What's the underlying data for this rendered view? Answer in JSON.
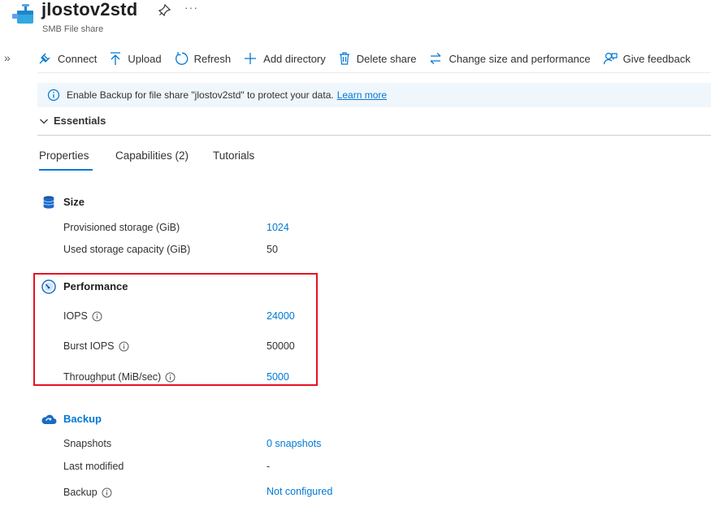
{
  "header": {
    "title": "jlostov2std",
    "subtitle": "SMB File share",
    "more": "···",
    "expand": "»"
  },
  "toolbar": {
    "connect": "Connect",
    "upload": "Upload",
    "refresh": "Refresh",
    "add_directory": "Add directory",
    "delete_share": "Delete share",
    "change_size": "Change size and performance",
    "give_feedback": "Give feedback"
  },
  "banner": {
    "text": "Enable Backup for file share \"jlostov2std\" to protect your data.",
    "link": "Learn more"
  },
  "essentials": {
    "label": "Essentials"
  },
  "tabs": {
    "properties": "Properties",
    "capabilities": "Capabilities (2)",
    "tutorials": "Tutorials"
  },
  "size": {
    "title": "Size",
    "provisioned_label": "Provisioned storage (GiB)",
    "provisioned_value": "1024",
    "used_label": "Used storage capacity (GiB)",
    "used_value": "50"
  },
  "performance": {
    "title": "Performance",
    "iops_label": "IOPS",
    "iops_value": "24000",
    "burst_label": "Burst IOPS",
    "burst_value": "50000",
    "throughput_label": "Throughput (MiB/sec)",
    "throughput_value": "5000"
  },
  "backup": {
    "title": "Backup",
    "snapshots_label": "Snapshots",
    "snapshots_value": "0 snapshots",
    "last_modified_label": "Last modified",
    "last_modified_value": "-",
    "backup_label": "Backup",
    "backup_value": "Not configured"
  },
  "colors": {
    "accent": "#0078d4",
    "highlight_border": "#e81123",
    "banner_bg": "#eff6fc"
  },
  "icons": {
    "resource": "file-share-icon",
    "pin": "pin-icon",
    "connect": "plug-icon",
    "upload": "upload-arrow-icon",
    "refresh": "refresh-icon",
    "add_directory": "plus-icon",
    "delete_share": "trash-icon",
    "change_size": "swap-arrows-icon",
    "give_feedback": "feedback-person-icon",
    "info": "info-icon",
    "size": "database-icon",
    "performance": "gauge-icon",
    "backup": "cloud-backup-icon"
  }
}
